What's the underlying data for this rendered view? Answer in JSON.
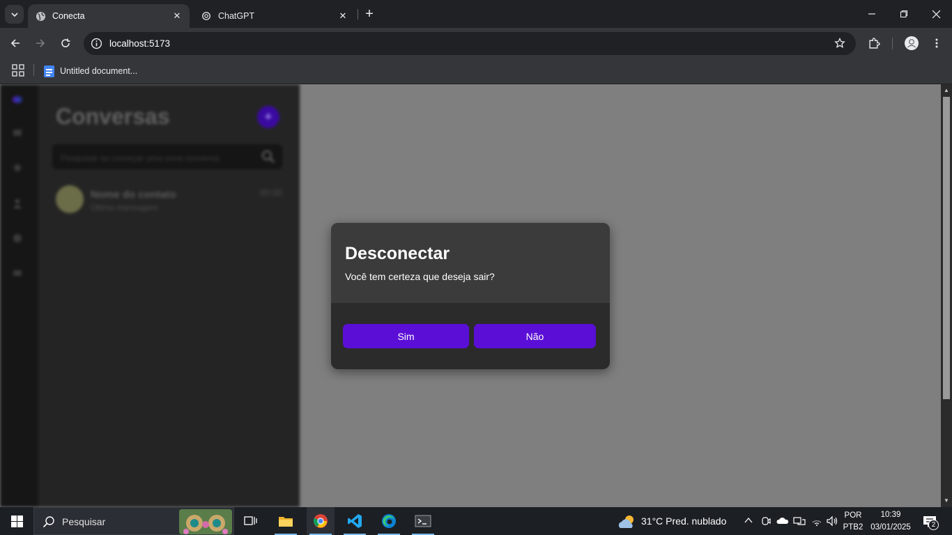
{
  "browser": {
    "tabs": [
      {
        "title": "Conecta",
        "active": true
      },
      {
        "title": "ChatGPT",
        "active": false
      }
    ],
    "url": "localhost:5173",
    "bookmarks": [
      {
        "label": "Untitled document..."
      }
    ]
  },
  "app": {
    "sidebar": {
      "title": "Conversas",
      "search_placeholder": "Pesquisar ou começar uma nova conversa",
      "contacts": [
        {
          "name": "Nome do contato",
          "last_message": "Última mensagem",
          "time": "00:00"
        }
      ]
    },
    "modal": {
      "title": "Desconectar",
      "message": "Você tem certeza que deseja sair?",
      "confirm_label": "Sim",
      "cancel_label": "Não"
    },
    "colors": {
      "accent": "#5b0fd6",
      "overlay": "#7f7f7f"
    }
  },
  "taskbar": {
    "search_placeholder": "Pesquisar",
    "weather": "31°C  Pred. nublado",
    "language": "POR",
    "keyboard": "PTB2",
    "time": "10:39",
    "date": "03/01/2025",
    "notifications": "2"
  }
}
